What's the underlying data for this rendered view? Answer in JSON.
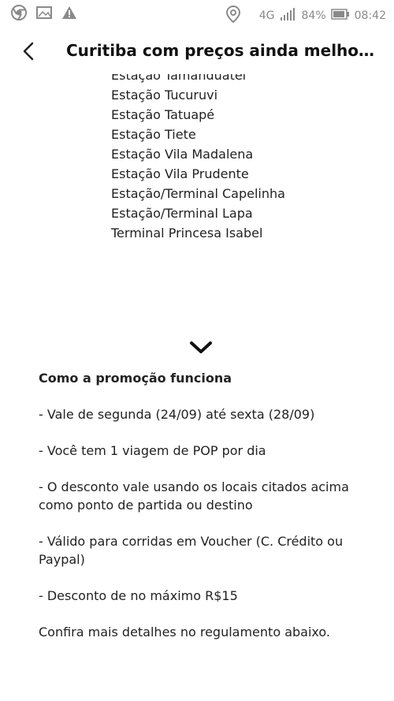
{
  "status_bar": {
    "network": "4G",
    "battery": "84%",
    "time": "08:42"
  },
  "header": {
    "title": "Curitiba com preços ainda melho…"
  },
  "stations": [
    "Estação Tamanduateí",
    "Estação Tucuruvi",
    "Estação Tatuapé",
    "Estação Tiete",
    "Estação Vila Madalena",
    "Estação Vila Prudente",
    "Estação/Terminal Capelinha",
    "Estação/Terminal Lapa",
    "Terminal Princesa Isabel"
  ],
  "promo": {
    "heading": "Como a promoção funciona",
    "items": [
      "- Vale de segunda (24/09) até sexta (28/09)",
      "- Você tem 1 viagem de POP por dia",
      "- O desconto vale usando os locais citados acima como ponto de partida ou destino",
      "- Válido para corridas em Voucher (C. Crédito ou Paypal)",
      "- Desconto de no máximo R$15"
    ],
    "footer": "Confira mais detalhes no regulamento abaixo."
  }
}
